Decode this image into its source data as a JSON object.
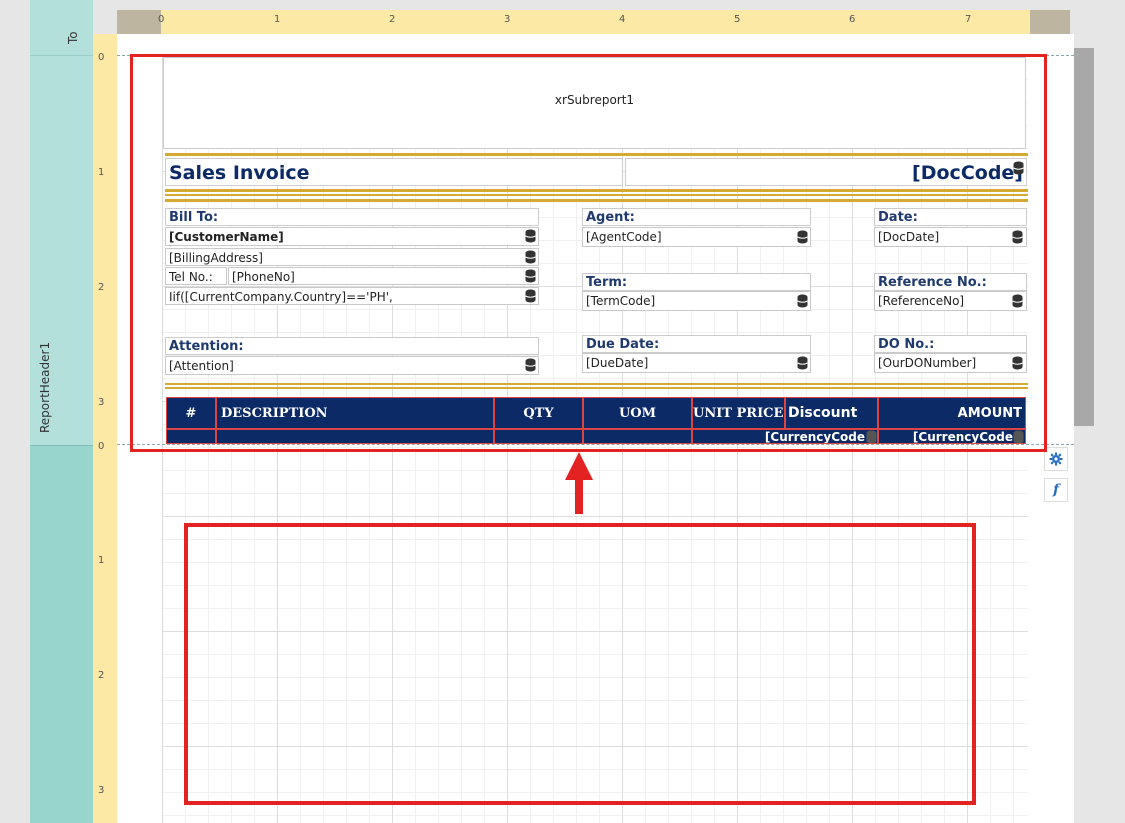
{
  "bands": {
    "top_label": "To",
    "report_header_label": "ReportHeader1"
  },
  "ruler": {
    "h_ticks": [
      "0",
      "1",
      "2",
      "3",
      "4",
      "5",
      "6",
      "7"
    ],
    "v_ticks_header": [
      "0",
      "1",
      "2",
      "3"
    ],
    "v_ticks_detail": [
      "0",
      "1",
      "2",
      "3"
    ]
  },
  "subreport": {
    "label": "xrSubreport1"
  },
  "invoice": {
    "title": "Sales Invoice",
    "doc_code": "[DocCode]",
    "bill_to_label": "Bill To:",
    "customer_name": "[CustomerName]",
    "billing_address": "[BillingAddress]",
    "tel_label": "Tel No.:",
    "phone_no": "[PhoneNo]",
    "country_expr": "Iif([CurrentCompany.Country]=='PH',",
    "attention_label": "Attention:",
    "attention": "[Attention]",
    "agent_label": "Agent:",
    "agent_code": "[AgentCode]",
    "term_label": "Term:",
    "term_code": "[TermCode]",
    "due_date_label": "Due Date:",
    "due_date": "[DueDate]",
    "date_label": "Date:",
    "doc_date": "[DocDate]",
    "reference_label": "Reference No.:",
    "reference_no": "[ReferenceNo]",
    "do_label": "DO No.:",
    "do_number": "[OurDONumber]"
  },
  "table": {
    "headers": [
      "#",
      "DESCRIPTION",
      "QTY",
      "UOM",
      "UNIT PRICE",
      "Discount",
      "AMOUNT"
    ],
    "currency_1": "[CurrencyCode",
    "currency_2": "[CurrencyCode"
  },
  "icons": {
    "settings": "gear-icon",
    "function": "function-icon",
    "function_glyph": "f"
  },
  "colors": {
    "accent_navy": "#0c2a66",
    "gold": "#d4aa31",
    "highlight_red": "#e32222",
    "band_teal": "#b3e0da"
  }
}
